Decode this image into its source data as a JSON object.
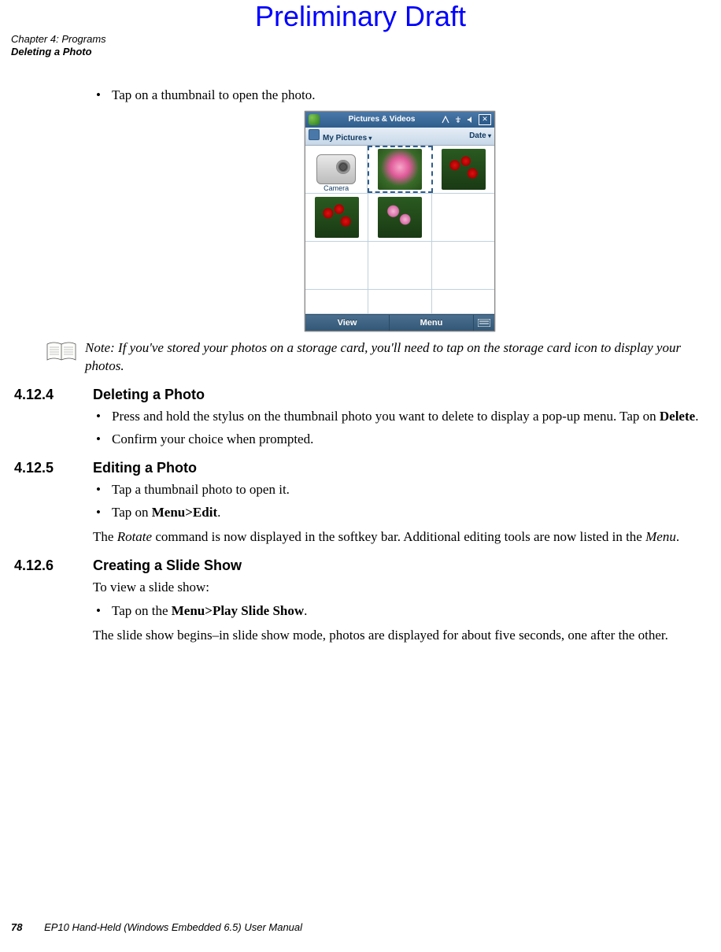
{
  "watermark": "Preliminary Draft",
  "header": {
    "chapter_line": "Chapter 4: Programs",
    "section_line": "Deleting a Photo"
  },
  "intro_bullet": "Tap on a thumbnail to open the photo.",
  "screenshot": {
    "titlebar": {
      "title": "Pictures & Videos"
    },
    "subbar": {
      "left": "My Pictures",
      "right": "Date"
    },
    "camera_caption": "Camera",
    "softkeys": {
      "left": "View",
      "right": "Menu"
    }
  },
  "note": {
    "prefix": "Note:",
    "text": "If you've stored your photos on a storage card, you'll need to tap on the storage card icon to display your photos."
  },
  "section_4_12_4": {
    "num": "4.12.4",
    "title": "Deleting a Photo",
    "bullets": [
      {
        "pre": "Press and hold the stylus on the thumbnail photo you want to delete to display a pop-up menu. Tap on ",
        "bold": "Delete",
        "post": "."
      },
      {
        "pre": "Confirm your choice when prompted.",
        "bold": "",
        "post": ""
      }
    ]
  },
  "section_4_12_5": {
    "num": "4.12.5",
    "title": "Editing a Photo",
    "bullets": [
      {
        "pre": "Tap a thumbnail photo to open it.",
        "bold": "",
        "post": ""
      },
      {
        "pre": "Tap on ",
        "bold": "Menu>Edit",
        "post": "."
      }
    ],
    "para_parts": {
      "p1": "The ",
      "i1": "Rotate",
      "p2": " command is now displayed in the softkey bar. Additional editing tools are now listed in the ",
      "i2": "Menu",
      "p3": "."
    }
  },
  "section_4_12_6": {
    "num": "4.12.6",
    "title": "Creating a Slide Show",
    "intro": "To view a slide show:",
    "bullets": [
      {
        "pre": "Tap on the ",
        "bold": "Menu>Play Slide Show",
        "post": "."
      }
    ],
    "para": "The slide show begins–in slide show mode, photos are displayed for about five seconds, one after the other."
  },
  "footer": {
    "page": "78",
    "manual": "EP10 Hand-Held (Windows Embedded 6.5) User Manual"
  }
}
